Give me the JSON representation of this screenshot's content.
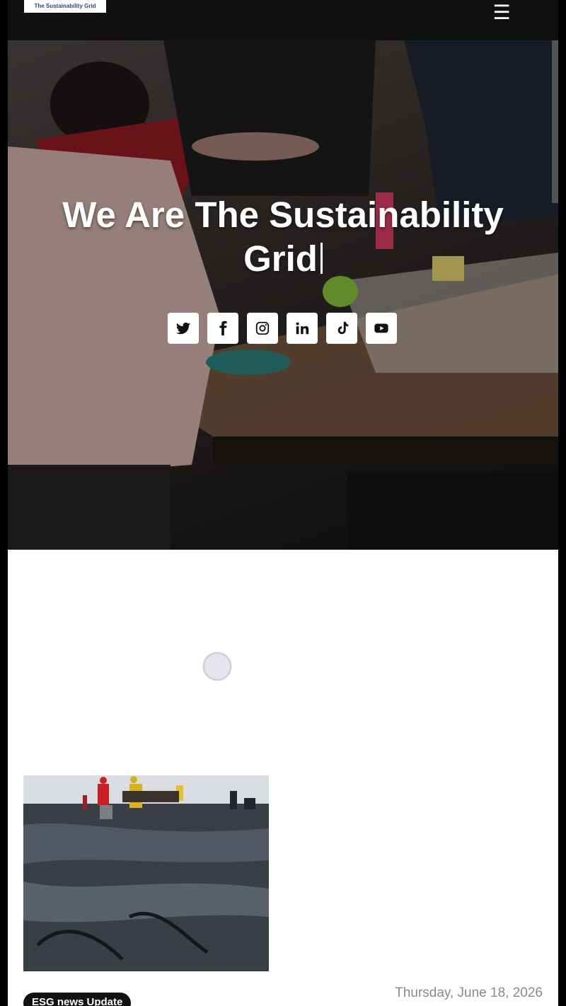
{
  "header": {
    "logo_text": "The Sustainability Grid",
    "menu_icon": "hamburger-menu-icon"
  },
  "hero": {
    "title": "We Are The Sustainability Grid",
    "social_icons": [
      "twitter-icon",
      "facebook-icon",
      "instagram-icon",
      "linkedin-icon",
      "tiktok-icon",
      "youtube-icon"
    ]
  },
  "article": {
    "tag": "ESG news Update",
    "date": "Thursday, June 18, 2026"
  },
  "colors": {
    "topbar": "#111011",
    "tag_bg": "#111111",
    "date_text": "#8a8a8a"
  }
}
